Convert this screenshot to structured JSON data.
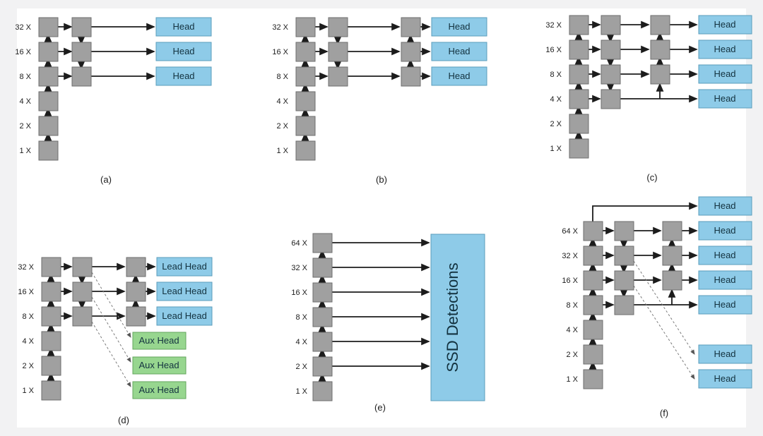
{
  "figure": {
    "background_color": "#f2f2f3",
    "surface_color": "#ffffff",
    "block_color": "#a0a0a0",
    "block_stroke": "#6e6e6e",
    "head_color": "#8ecbe8",
    "head_stroke": "#5b9dbb",
    "aux_head_color": "#97d68f",
    "aux_head_stroke": "#63a65c",
    "arrow_color": "#1c1c1c",
    "dashed_color": "#7a7a7a"
  },
  "scale_labels": {
    "s64": "64 X",
    "s32": "32 X",
    "s16": "16 X",
    "s8": "8 X",
    "s4": "4 X",
    "s2": "2 X",
    "s1": "1 X"
  },
  "head_labels": {
    "head": "Head",
    "lead_head": "Lead Head",
    "aux_head": "Aux Head",
    "ssd": "SSD Detections"
  },
  "panels": [
    {
      "id": "a",
      "caption": "(a)",
      "scales": [
        "32 X",
        "16 X",
        "8 X",
        "4 X",
        "2 X",
        "1 X"
      ],
      "backbone_blocks": 6,
      "stage_columns": 2,
      "column2_rows": [
        "32 X",
        "16 X",
        "8 X"
      ],
      "heads": [
        {
          "label": "Head",
          "type": "lead",
          "row": "32 X"
        },
        {
          "label": "Head",
          "type": "lead",
          "row": "16 X"
        },
        {
          "label": "Head",
          "type": "lead",
          "row": "8 X"
        }
      ],
      "dashed_links": []
    },
    {
      "id": "b",
      "caption": "(b)",
      "scales": [
        "32 X",
        "16 X",
        "8 X",
        "4 X",
        "2 X",
        "1 X"
      ],
      "backbone_blocks": 6,
      "stage_columns": 3,
      "column2_rows": [
        "32 X",
        "16 X",
        "8 X"
      ],
      "column3_rows": [
        "32 X",
        "16 X",
        "8 X"
      ],
      "heads": [
        {
          "label": "Head",
          "type": "lead",
          "row": "32 X"
        },
        {
          "label": "Head",
          "type": "lead",
          "row": "16 X"
        },
        {
          "label": "Head",
          "type": "lead",
          "row": "8 X"
        }
      ],
      "dashed_links": []
    },
    {
      "id": "c",
      "caption": "(c)",
      "scales": [
        "32 X",
        "16 X",
        "8 X",
        "4 X",
        "2 X",
        "1 X"
      ],
      "backbone_blocks": 6,
      "stage_columns": 3,
      "column2_rows": [
        "32 X",
        "16 X",
        "8 X",
        "4 X"
      ],
      "column3_rows": [
        "32 X",
        "16 X",
        "8 X"
      ],
      "heads": [
        {
          "label": "Head",
          "type": "lead",
          "row": "32 X"
        },
        {
          "label": "Head",
          "type": "lead",
          "row": "16 X"
        },
        {
          "label": "Head",
          "type": "lead",
          "row": "8 X"
        },
        {
          "label": "Head",
          "type": "lead",
          "row": "4 X"
        }
      ],
      "dashed_links": []
    },
    {
      "id": "d",
      "caption": "(d)",
      "scales": [
        "32 X",
        "16 X",
        "8 X",
        "4 X",
        "2 X",
        "1 X"
      ],
      "backbone_blocks": 6,
      "stage_columns": 3,
      "column2_rows": [
        "32 X",
        "16 X",
        "8 X"
      ],
      "column3_rows": [
        "32 X",
        "16 X",
        "8 X"
      ],
      "heads": [
        {
          "label": "Lead Head",
          "type": "lead",
          "row": "32 X"
        },
        {
          "label": "Lead Head",
          "type": "lead",
          "row": "16 X"
        },
        {
          "label": "Lead Head",
          "type": "lead",
          "row": "8 X"
        },
        {
          "label": "Aux Head",
          "type": "aux",
          "row": "4 X"
        },
        {
          "label": "Aux Head",
          "type": "aux",
          "row": "2 X"
        },
        {
          "label": "Aux Head",
          "type": "aux",
          "row": "1 X"
        }
      ],
      "dashed_links": [
        {
          "from_row": "32 X",
          "to_head_row": "4 X"
        },
        {
          "from_row": "16 X",
          "to_head_row": "2 X"
        },
        {
          "from_row": "8 X",
          "to_head_row": "1 X"
        }
      ]
    },
    {
      "id": "e",
      "caption": "(e)",
      "scales": [
        "64 X",
        "32 X",
        "16 X",
        "8 X",
        "4 X",
        "2 X",
        "1 X"
      ],
      "backbone_blocks": 7,
      "stage_columns": 1,
      "detector_label": "SSD Detections",
      "detector_feed_rows": [
        "64 X",
        "32 X",
        "16 X",
        "8 X",
        "4 X",
        "2 X"
      ],
      "heads": [],
      "dashed_links": []
    },
    {
      "id": "f",
      "caption": "(f)",
      "scales": [
        "64 X",
        "32 X",
        "16 X",
        "8 X",
        "4 X",
        "2 X",
        "1 X"
      ],
      "backbone_blocks": 7,
      "stage_columns": 3,
      "column2_rows": [
        "64 X",
        "32 X",
        "16 X",
        "8 X"
      ],
      "column3_rows": [
        "64 X",
        "32 X",
        "16 X"
      ],
      "heads": [
        {
          "label": "Head",
          "type": "lead",
          "row": "top"
        },
        {
          "label": "Head",
          "type": "lead",
          "row": "64 X"
        },
        {
          "label": "Head",
          "type": "lead",
          "row": "32 X"
        },
        {
          "label": "Head",
          "type": "lead",
          "row": "16 X"
        },
        {
          "label": "Head",
          "type": "lead",
          "row": "8 X"
        },
        {
          "label": "Head",
          "type": "lead",
          "row": "2 X"
        },
        {
          "label": "Head",
          "type": "lead",
          "row": "1 X"
        }
      ],
      "dashed_links": [
        {
          "from_row": "32 X",
          "to_head_row": "2 X"
        },
        {
          "from_row": "16 X",
          "to_head_row": "1 X"
        }
      ]
    }
  ]
}
